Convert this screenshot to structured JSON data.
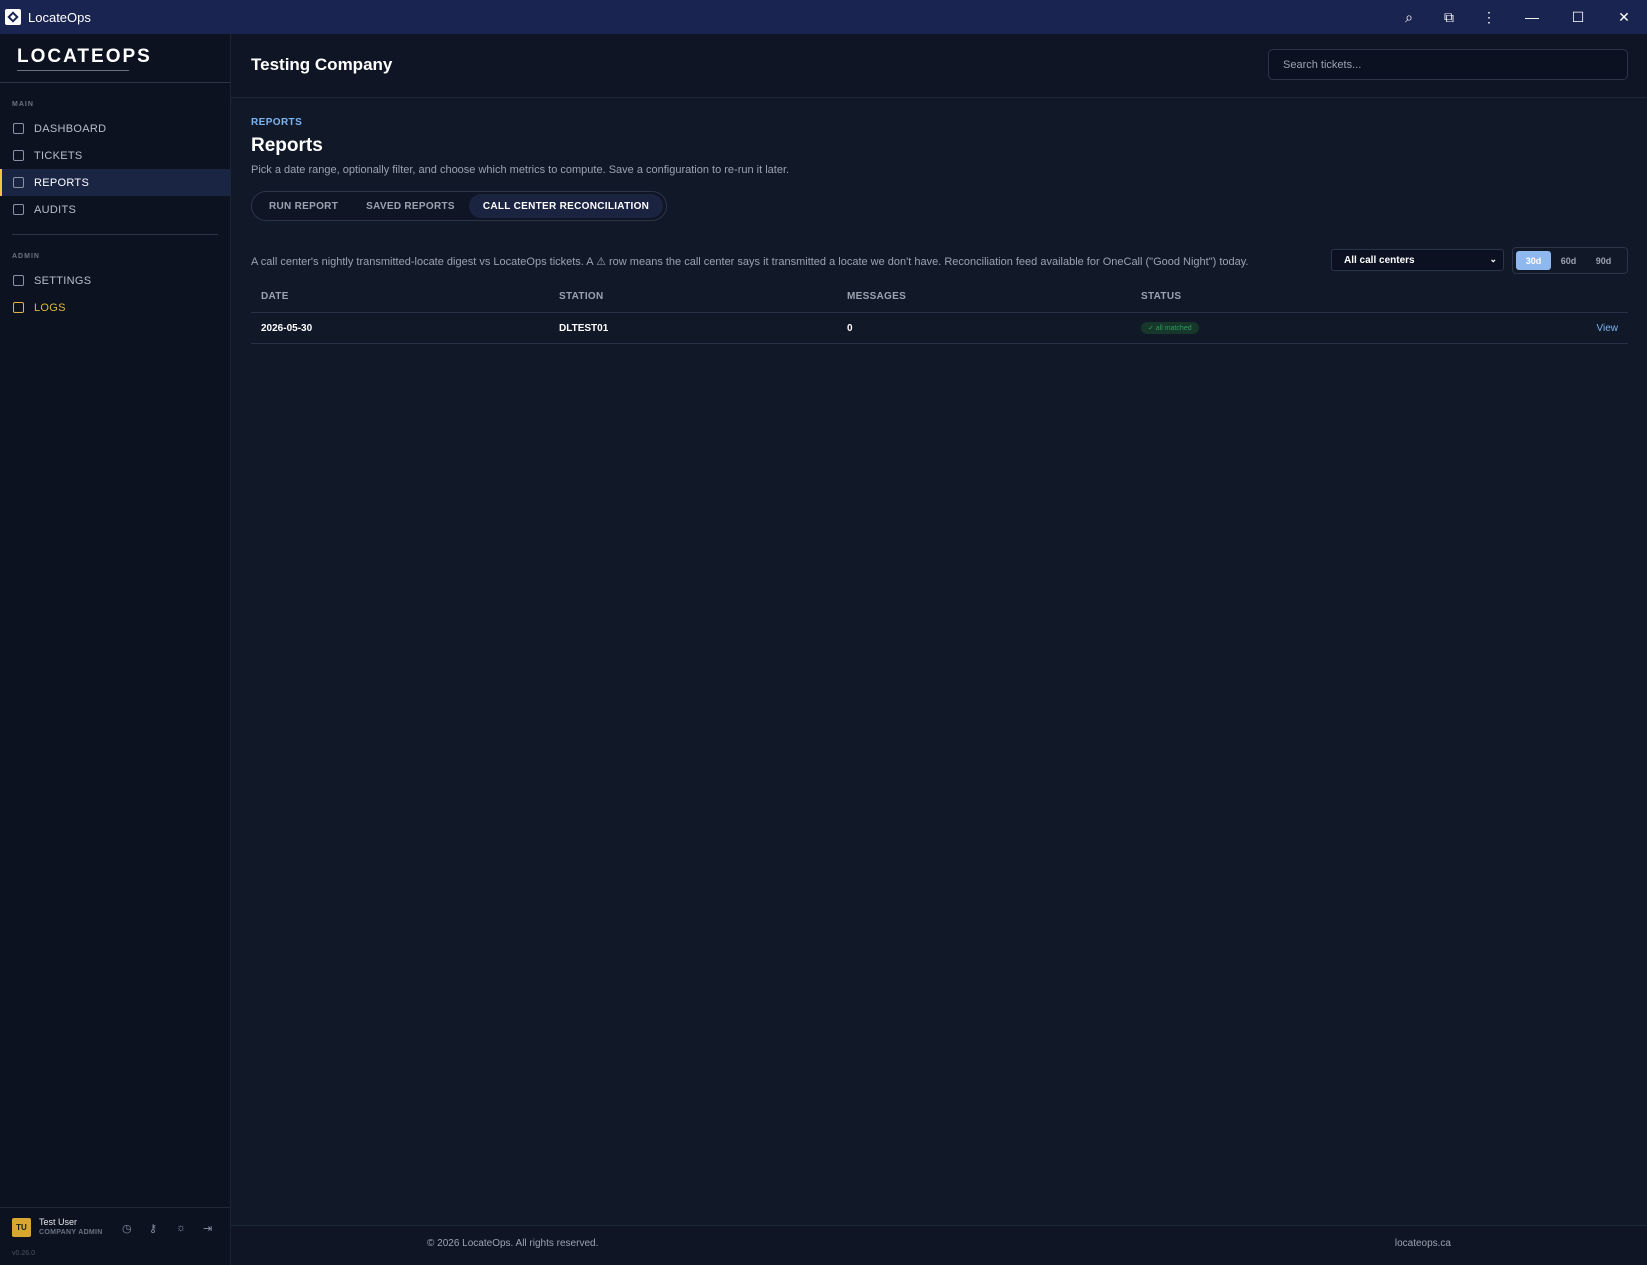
{
  "window": {
    "title": "LocateOps",
    "controls": [
      "search-icon",
      "extension-icon",
      "more-icon",
      "minimize-icon",
      "maximize-icon",
      "close-icon"
    ]
  },
  "sidebar": {
    "logo": "LOCATEOPS",
    "main_label": "MAIN",
    "admin_label": "ADMIN",
    "items": [
      {
        "label": "DASHBOARD",
        "icon": "dashboard-icon"
      },
      {
        "label": "TICKETS",
        "icon": "ticket-icon"
      },
      {
        "label": "REPORTS",
        "icon": "chart-icon",
        "active": true
      },
      {
        "label": "AUDITS",
        "icon": "clipboard-icon"
      }
    ],
    "admin_items": [
      {
        "label": "SETTINGS",
        "icon": "gear-icon"
      },
      {
        "label": "LOGS",
        "icon": "document-icon",
        "color": "#e3b341"
      }
    ],
    "user": {
      "initials": "TU",
      "name": "Test User",
      "role": "COMPANY ADMIN",
      "version": "v0.26.0"
    }
  },
  "header": {
    "company": "Testing Company",
    "search_placeholder": "Search tickets..."
  },
  "page": {
    "breadcrumb": "REPORTS",
    "title": "Reports",
    "description": "Pick a date range, optionally filter, and choose which metrics to compute. Save a configuration to re-run it later.",
    "tabs": [
      {
        "label": "RUN REPORT"
      },
      {
        "label": "SAVED REPORTS"
      },
      {
        "label": "CALL CENTER RECONCILIATION",
        "active": true
      }
    ],
    "recon_description": "A call center's nightly transmitted-locate digest vs LocateOps tickets. A ⚠ row means the call center says it transmitted a locate we don't have. Reconciliation feed available for OneCall (\"Good Night\") today.",
    "call_center_select": "All call centers",
    "ranges": [
      "30d",
      "60d",
      "90d"
    ],
    "active_range": "30d",
    "table": {
      "headers": [
        "DATE",
        "STATION",
        "MESSAGES",
        "STATUS"
      ],
      "rows": [
        {
          "date": "2026-05-30",
          "station": "DLTEST01",
          "messages": "0",
          "status": "✓ all matched",
          "action": "View"
        }
      ]
    }
  },
  "footer": {
    "copyright": "© 2026 LocateOps. All rights reserved.",
    "site": "locateops.ca"
  },
  "colors": {
    "accent": "#f5c542",
    "link": "#7cb5f4",
    "background": "#111828",
    "titlebar": "#1a2451"
  }
}
